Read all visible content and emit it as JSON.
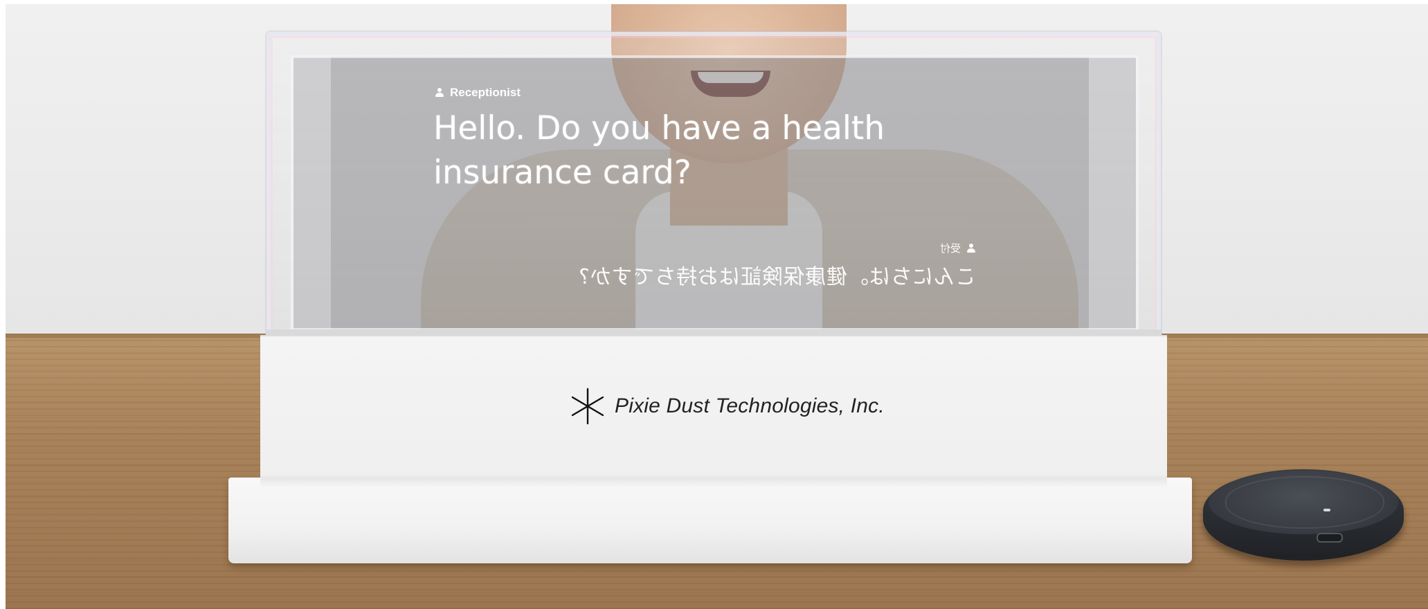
{
  "display": {
    "speaker_label": "Receptionist",
    "caption_en": "Hello. Do you have a health insurance card?",
    "jp_speaker_label": "受付",
    "caption_jp": "こんにちは。健康保険証はお持ちですか?"
  },
  "base": {
    "brand": "Pixie Dust Technologies, Inc.",
    "logo_icon": "asterisk-logo-icon"
  },
  "device": {
    "name_icon": "speakerphone-puck"
  },
  "colors": {
    "caption_text": "#ffffff",
    "base_white": "#f2f2f2",
    "wood": "#a8825a"
  }
}
